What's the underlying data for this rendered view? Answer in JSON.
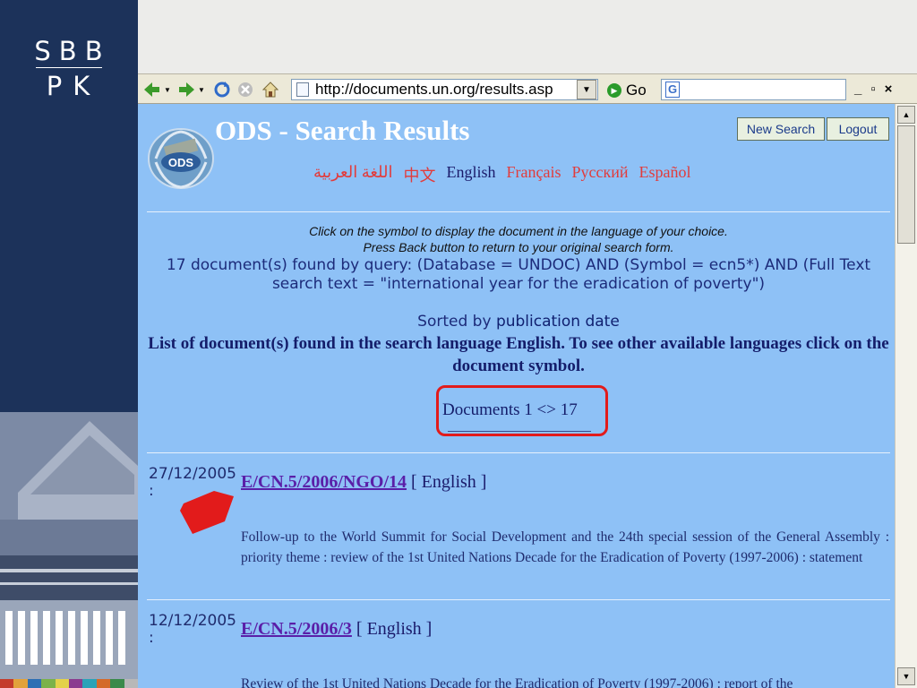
{
  "slide": {
    "logo_line1": "SBB",
    "logo_line2": "PK",
    "strip_colors": [
      "#c43c2c",
      "#e2a23b",
      "#2d6fb4",
      "#7bb24a",
      "#e3d24a",
      "#8b3b8f",
      "#2aa3b8",
      "#d46a2a",
      "#3a8a4a",
      "#b8b8b8"
    ]
  },
  "browser": {
    "address_url": "http://documents.un.org/results.asp",
    "go_label": "Go",
    "search_text": "",
    "window_controls": [
      "_",
      "▫",
      "×"
    ]
  },
  "page": {
    "title": "ODS - Search Results",
    "logo_text": "ODS",
    "new_search_label": "New Search",
    "logout_label": "Logout",
    "languages": [
      {
        "label": "اللغة العربية",
        "current": false
      },
      {
        "label": "中文",
        "current": false
      },
      {
        "label": "English",
        "current": true
      },
      {
        "label": "Français",
        "current": false
      },
      {
        "label": "Русский",
        "current": false
      },
      {
        "label": "Español",
        "current": false
      }
    ],
    "instruction1": "Click on the symbol to display the document in the language of your choice.",
    "instruction2": "Press Back button to return to your original search form.",
    "query_text": "17 document(s) found by query: (Database = UNDOC) AND (Symbol = ecn5*) AND (Full Text search text = \"international year for the eradication of poverty\")",
    "sorted_label": "Sorted by",
    "sorted_value": "publication date",
    "list_note": "List of document(s) found in the search language English. To see other available languages click on the document symbol.",
    "documents_range": "Documents  1 <> 17"
  },
  "results": [
    {
      "date": "27/12/2005",
      "date_suffix": ":",
      "symbol": "E/CN.5/2006/NGO/14",
      "lang": "[ English ]",
      "description": "Follow-up to the World Summit for Social Development and the 24th special session of the General Assembly : priority theme : review of the 1st United Nations Decade for the Eradication of Poverty (1997-2006) : statement"
    },
    {
      "date": "12/12/2005",
      "date_suffix": ":",
      "symbol": "E/CN.5/2006/3",
      "lang": "[ English ]",
      "description": "Review of the 1st United Nations Decade for the Eradication of Poverty (1997-2006) : report of the"
    }
  ],
  "colors": {
    "content_bg": "#8ec1f6",
    "slide_bg": "#1c325a",
    "highlight_red": "#e21b1b",
    "language_red": "#e23b3b"
  }
}
